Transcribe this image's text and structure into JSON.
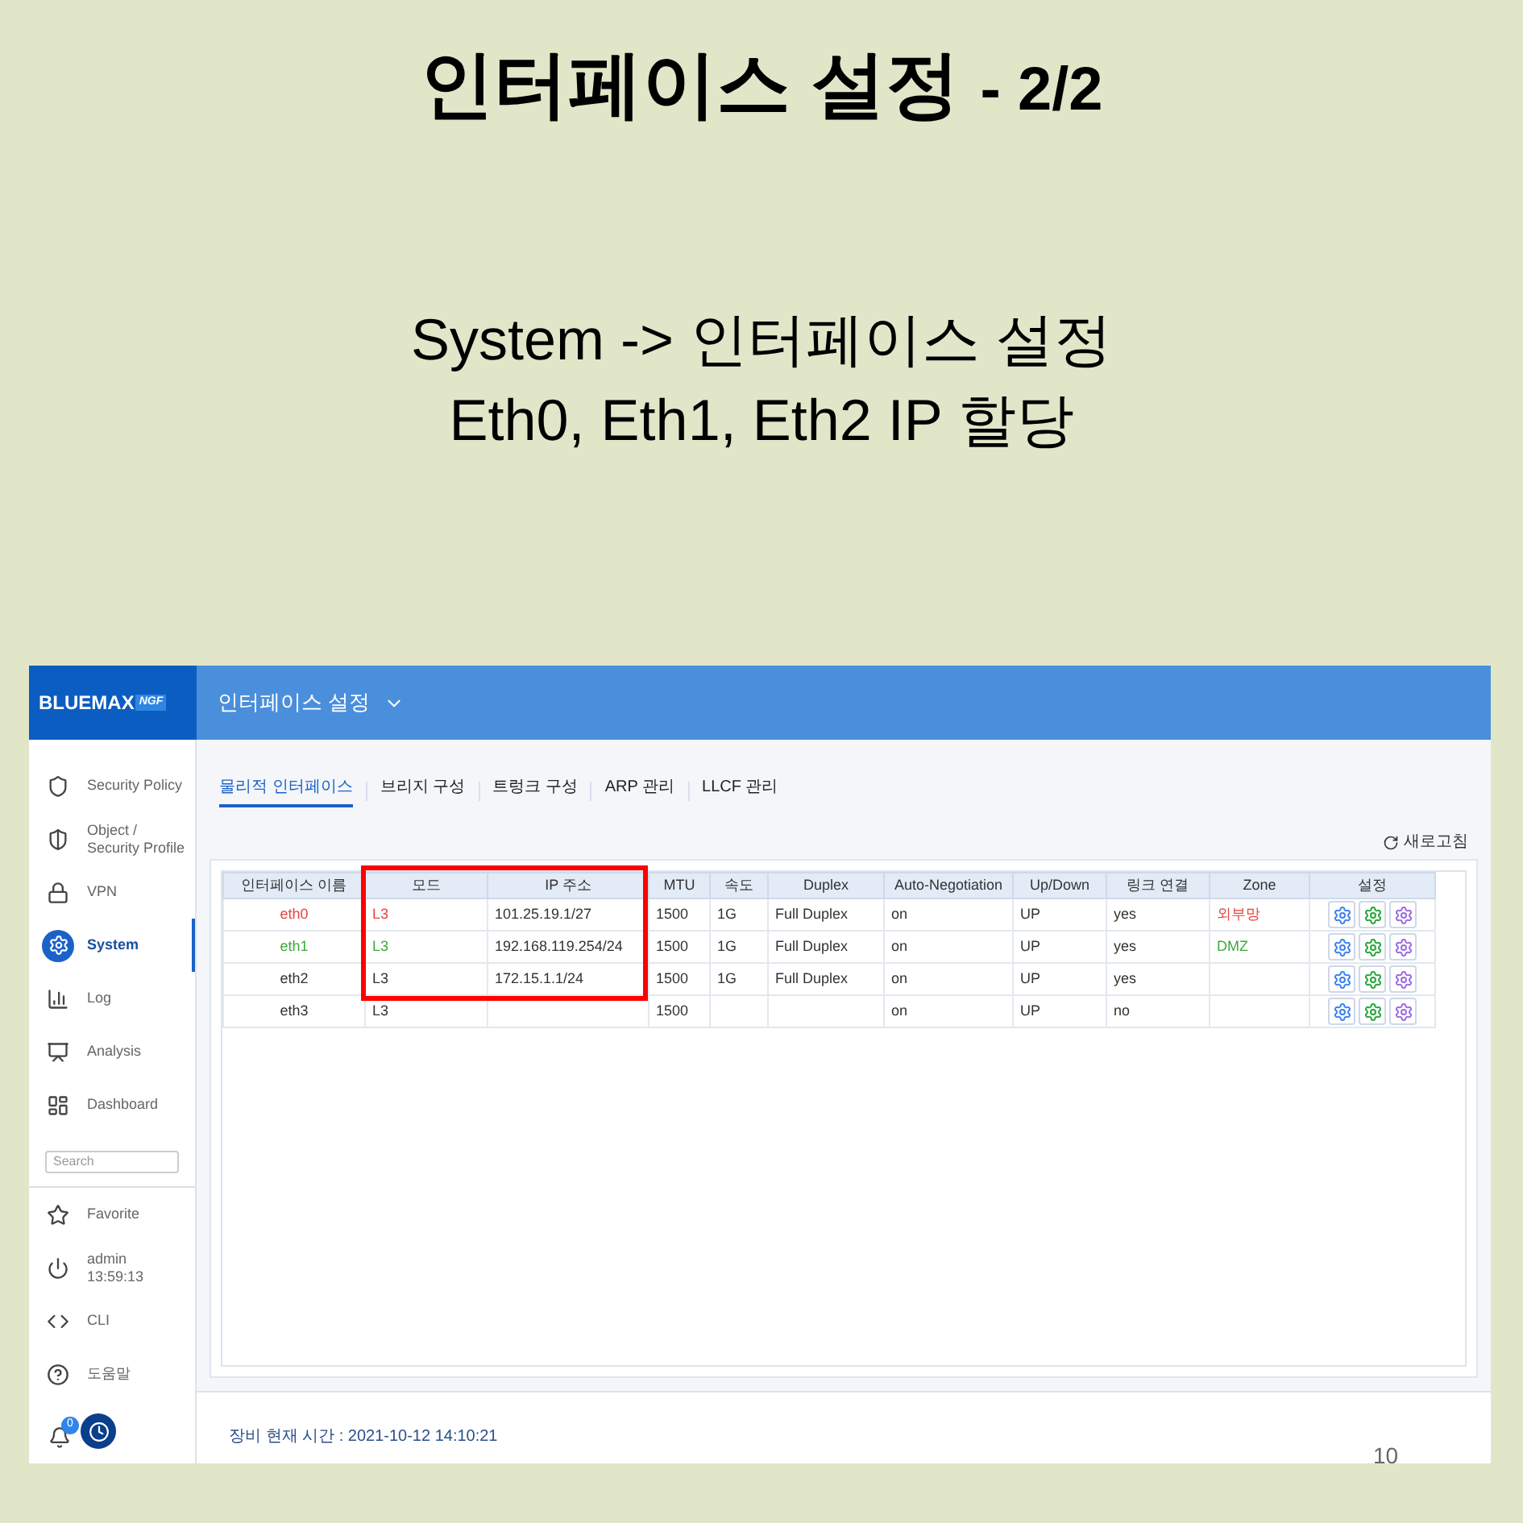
{
  "slide": {
    "title": "인터페이스 설정",
    "title_suffix": "- 2/2",
    "lines": [
      "System -> 인터페이스 설정",
      "Eth0, Eth1, Eth2 IP 할당"
    ],
    "page_number": "10"
  },
  "app": {
    "logo": "BLUEMAX",
    "logo_badge": "NGF",
    "header_title": "인터페이스 설정",
    "sidebar": [
      {
        "kind": "nav",
        "label": "Security Policy",
        "selected": false
      },
      {
        "kind": "nav",
        "label": "Object /",
        "label2": "Security Profile",
        "selected": false
      },
      {
        "kind": "nav",
        "label": "VPN",
        "selected": false
      },
      {
        "kind": "nav",
        "label": "System",
        "selected": true
      },
      {
        "kind": "nav",
        "label": "Log",
        "selected": false
      },
      {
        "kind": "nav",
        "label": "Analysis",
        "selected": false
      },
      {
        "kind": "nav",
        "label": "Dashboard",
        "selected": false
      },
      {
        "kind": "search",
        "placeholder": "Search"
      },
      {
        "kind": "nav",
        "label": "Favorite",
        "selected": false
      },
      {
        "kind": "nav",
        "label": "admin",
        "label2": "13:59:13",
        "selected": false
      },
      {
        "kind": "nav",
        "label": "CLI",
        "selected": false
      },
      {
        "kind": "nav",
        "label": "도움말",
        "selected": false
      }
    ],
    "notification_count": "0",
    "tabs": [
      {
        "label": "물리적 인터페이스",
        "selected": true
      },
      {
        "label": "브리지 구성",
        "selected": false
      },
      {
        "label": "트렁크 구성",
        "selected": false
      },
      {
        "label": "ARP 관리",
        "selected": false
      },
      {
        "label": "LLCF 관리",
        "selected": false
      }
    ],
    "refresh": "새로고침",
    "table": {
      "columns": [
        "인터페이스 이름",
        "모드",
        "IP 주소",
        "MTU",
        "속도",
        "Duplex",
        "Auto-Negotiation",
        "Up/Down",
        "링크 연결",
        "Zone",
        "설정"
      ],
      "rows": [
        {
          "color": "#e8413c",
          "name": "eth0",
          "mode": "L3",
          "ip": "101.25.19.1/27",
          "mtu": "1500",
          "speed": "1G",
          "duplex": "Full Duplex",
          "auto": "on",
          "updown": "UP",
          "link": "yes",
          "zone": "외부망"
        },
        {
          "color": "#3aaa3a",
          "name": "eth1",
          "mode": "L3",
          "ip": "192.168.119.254/24",
          "mtu": "1500",
          "speed": "1G",
          "duplex": "Full Duplex",
          "auto": "on",
          "updown": "UP",
          "link": "yes",
          "zone": "DMZ"
        },
        {
          "color": "#333333",
          "name": "eth2",
          "mode": "L3",
          "ip": "172.15.1.1/24",
          "mtu": "1500",
          "speed": "1G",
          "duplex": "Full Duplex",
          "auto": "on",
          "updown": "UP",
          "link": "yes"
        },
        {
          "color": "#333333",
          "name": "eth3",
          "mode": "L3",
          "mtu": "1500",
          "auto": "on",
          "updown": "UP",
          "link": "no"
        }
      ]
    },
    "footer": "장비 현재 시간 : 2021-10-12 14:10:21"
  }
}
